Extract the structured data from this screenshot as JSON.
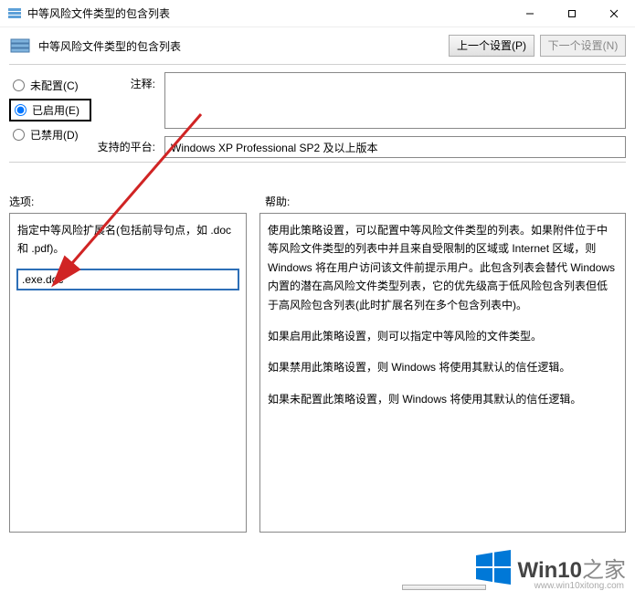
{
  "window": {
    "title": "中等风险文件类型的包含列表",
    "minimize_tip": "最小化",
    "maximize_tip": "最大化",
    "close_tip": "关闭"
  },
  "header": {
    "title": "中等风险文件类型的包含列表",
    "prev_setting": "上一个设置(P)",
    "next_setting": "下一个设置(N)"
  },
  "radios": {
    "not_configured": "未配置(C)",
    "enabled": "已启用(E)",
    "disabled": "已禁用(D)"
  },
  "labels": {
    "comment": "注释:",
    "platform": "支持的平台:",
    "options": "选项:",
    "help": "帮助:"
  },
  "fields": {
    "comment_value": "",
    "platform_value": "Windows XP Professional SP2 及以上版本"
  },
  "options": {
    "desc": "指定中等风险扩展名(包括前导句点，如 .doc 和 .pdf)。",
    "input_value": ".exe.doc"
  },
  "help": {
    "p1": "使用此策略设置，可以配置中等风险文件类型的列表。如果附件位于中等风险文件类型的列表中并且来自受限制的区域或 Internet 区域，则 Windows 将在用户访问该文件前提示用户。此包含列表会替代 Windows 内置的潜在高风险文件类型列表，它的优先级高于低风险包含列表但低于高风险包含列表(此时扩展名列在多个包含列表中)。",
    "p2": "如果启用此策略设置，则可以指定中等风险的文件类型。",
    "p3": "如果禁用此策略设置，则 Windows 将使用其默认的信任逻辑。",
    "p4": "如果未配置此策略设置，则 Windows 将使用其默认的信任逻辑。"
  },
  "watermark": {
    "brand_main": "Win10",
    "brand_sub": "之家",
    "url": "www.win10xitong.com"
  }
}
